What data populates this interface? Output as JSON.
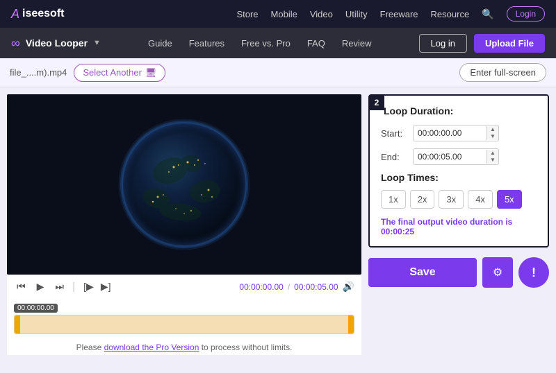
{
  "topnav": {
    "logo": "Aiseesoft",
    "links": [
      "Store",
      "Mobile",
      "Video",
      "Utility",
      "Freeware",
      "Resource"
    ],
    "login_label": "Login"
  },
  "secondnav": {
    "tool_title": "Video Looper",
    "links": [
      "Guide",
      "Features",
      "Free vs. Pro",
      "FAQ",
      "Review"
    ],
    "login_label": "Log in",
    "upload_label": "Upload File"
  },
  "toolbar": {
    "file_name": "file_....m).mp4",
    "select_another": "Select Another",
    "fullscreen": "Enter full-screen"
  },
  "video": {
    "current_time": "00:00:00.00",
    "total_time": "00:00:05.00",
    "timeline_indicator": "00:00:00.00"
  },
  "pro_notice": {
    "text_before": "Please ",
    "link_text": "download the Pro Version",
    "text_after": " to process without limits."
  },
  "loop_settings": {
    "box_number": "2",
    "duration_label": "Loop Duration:",
    "start_label": "Start:",
    "start_value": "00:00:00.00",
    "end_label": "End:",
    "end_value": "00:00:05.00",
    "times_label": "Loop Times:",
    "times_options": [
      "1x",
      "2x",
      "3x",
      "4x",
      "5x"
    ],
    "active_option": "5x",
    "output_text_before": "The final output video duration is ",
    "output_duration": "00:00:25"
  },
  "save_row": {
    "save_label": "Save"
  }
}
